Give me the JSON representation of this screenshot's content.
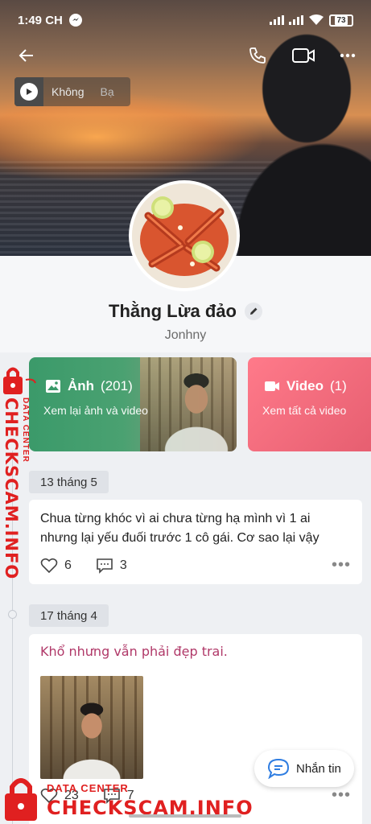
{
  "status_bar": {
    "time": "1:49 CH",
    "battery": "73"
  },
  "music": {
    "title": "Không",
    "title_tail": "Bạ"
  },
  "profile": {
    "name": "Thằng Lừa đảo",
    "subname": "Jonhny"
  },
  "cards": {
    "photos": {
      "label": "Ảnh",
      "count": "(201)",
      "subtitle": "Xem lại ảnh và video"
    },
    "videos": {
      "label": "Video",
      "count": "(1)",
      "subtitle": "Xem tất cả video"
    }
  },
  "posts": [
    {
      "date": "13 tháng 5",
      "text_line1": "Chua từng khóc vì ai chưa từng hạ mình vì 1 ai",
      "text_line2": "nhưng lại yếu đuối trước 1 cô gái. Cơ sao lại vậy",
      "likes": "6",
      "comments": "3"
    },
    {
      "date": "17 tháng 4",
      "text": "Khổ nhưng vẫn phải đẹp trai.",
      "likes": "23",
      "comments": "7"
    }
  ],
  "chat_button": {
    "label": "Nhắn tin"
  },
  "watermark": {
    "side_main": "CHECKSCAM.INFO",
    "side_sub": "DATA CENTER",
    "bottom_sub": "DATA CENTER",
    "bottom_main": "CHECKSCAM.INFO",
    "color": "#e02020"
  },
  "colors": {
    "photo_card": "#3b9a6a",
    "video_card": "#e55d6f",
    "accent_text": "#b03868",
    "chat_icon": "#2f7de1"
  }
}
